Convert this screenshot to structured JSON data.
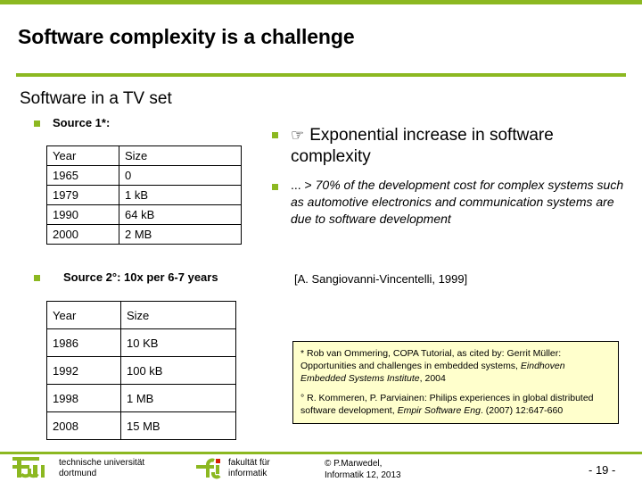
{
  "theme": {
    "accent_green": "#8cb821",
    "note_background": "#ffffcc",
    "text_color": "#000000"
  },
  "title": "Software complexity is a challenge",
  "left": {
    "subhead": "Software in a TV set",
    "source1_label": "Source 1*:",
    "source2_label": "Source 2°: 10x per 6-7 years",
    "table1": {
      "headers": [
        "Year",
        "Size"
      ],
      "rows": [
        [
          "1965",
          "0"
        ],
        [
          "1979",
          "1 kB"
        ],
        [
          "1990",
          "64 kB"
        ],
        [
          "2000",
          "2 MB"
        ]
      ]
    },
    "table2": {
      "headers": [
        "Year",
        "Size"
      ],
      "rows": [
        [
          "1986",
          "10 KB"
        ],
        [
          "1992",
          "100 kB"
        ],
        [
          "1998",
          "1 MB"
        ],
        [
          "2008",
          "15 MB"
        ]
      ]
    }
  },
  "right": {
    "hand_icon": "☞",
    "point1": "Exponential increase in software complexity",
    "point2_lead": "... > ",
    "point2": "70% of the development cost for complex systems such as automotive electronics and communication systems are due to software development",
    "citation": "[A. Sangiovanni-Vincentelli, 1999]"
  },
  "note": {
    "ref1_marker": "* ",
    "ref1_part1": "Rob van Ommering, COPA Tutorial, as cited by: Gerrit Müller: Opportunities and challenges in embedded systems, ",
    "ref1_italic": "Eindhoven Embedded Systems Institute",
    "ref1_part2": ", 2004",
    "ref2_marker": "° ",
    "ref2_part1": "R. Kommeren, P. Parviainen: Philips experiences in global distributed software development, ",
    "ref2_italic": "Empir Software Eng",
    "ref2_part2": ". (2007) 12:647-660"
  },
  "footer": {
    "university_line1": "technische universität",
    "university_line2": "dortmund",
    "faculty_line1": "fakultät für",
    "faculty_line2": "informatik",
    "copyright_line1": "© P.Marwedel,",
    "copyright_line2": "Informatik 12,  2013",
    "page_number": "-  19 -"
  }
}
